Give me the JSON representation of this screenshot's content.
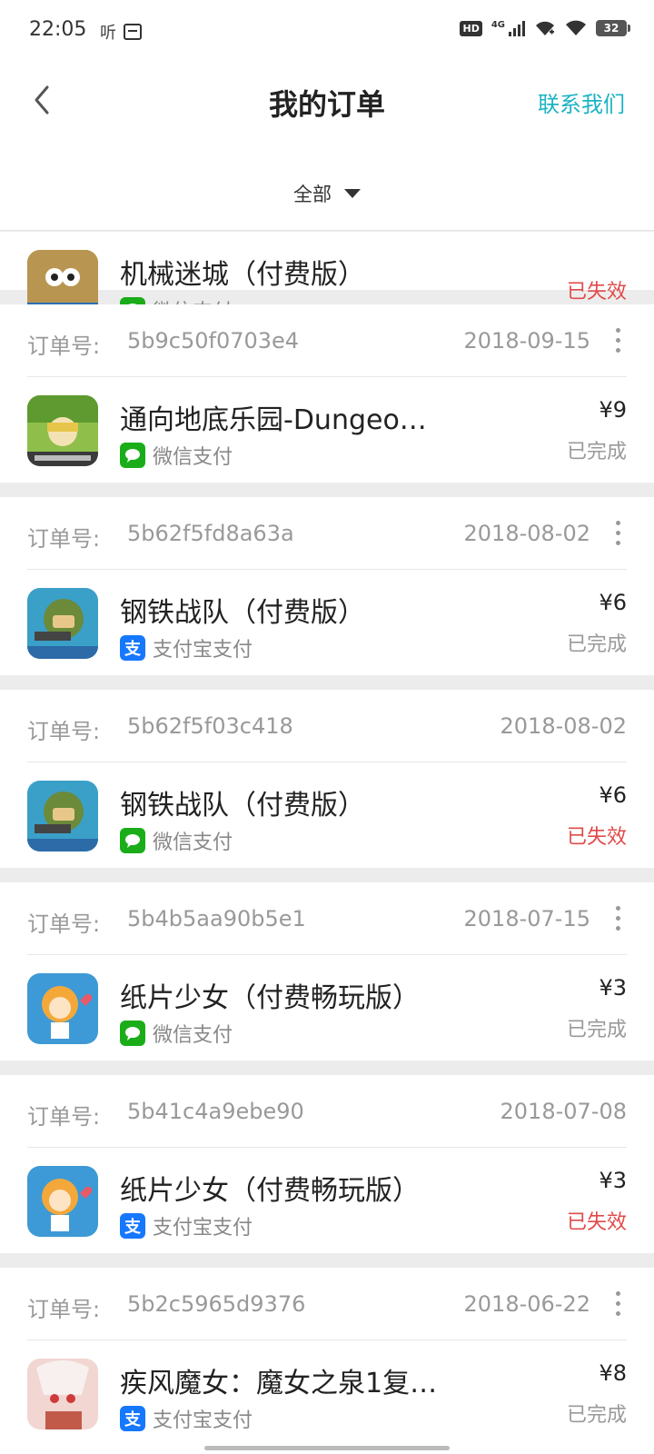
{
  "status_bar": {
    "time": "22:05",
    "listen_glyph": "听",
    "net_tag": "4G",
    "battery": "32"
  },
  "header": {
    "title": "我的订单",
    "contact": "联系我们"
  },
  "filter": {
    "selected": "全部"
  },
  "order_no_label": "订单号:",
  "orders": [
    {
      "app_name": "机械迷城（付费版）",
      "payment": "微信支付",
      "pay_type": "wechat",
      "status": "已失效",
      "status_type": "failed",
      "icon": "machinarium-icon"
    },
    {
      "order_no": "5b9c50f0703e4",
      "date": "2018-09-15",
      "app_name": "通向地底乐园-Dungeo…",
      "price": "¥9",
      "payment": "微信支付",
      "pay_type": "wechat",
      "status": "已完成",
      "status_type": "done",
      "icon": "game-coaster-icon"
    },
    {
      "order_no": "5b62f5fd8a63a",
      "date": "2018-08-02",
      "app_name": "钢铁战队（付费版）",
      "price": "¥6",
      "payment": "支付宝支付",
      "pay_type": "alipay",
      "status": "已完成",
      "status_type": "done",
      "icon": "iron-squad-icon"
    },
    {
      "order_no": "5b62f5f03c418",
      "date": "2018-08-02",
      "app_name": "钢铁战队（付费版）",
      "price": "¥6",
      "payment": "微信支付",
      "pay_type": "wechat",
      "status": "已失效",
      "status_type": "failed",
      "icon": "iron-squad-icon"
    },
    {
      "order_no": "5b4b5aa90b5e1",
      "date": "2018-07-15",
      "app_name": "纸片少女（付费畅玩版）",
      "price": "¥3",
      "payment": "微信支付",
      "pay_type": "wechat",
      "status": "已完成",
      "status_type": "done",
      "icon": "paper-girl-icon"
    },
    {
      "order_no": "5b41c4a9ebe90",
      "date": "2018-07-08",
      "app_name": "纸片少女（付费畅玩版）",
      "price": "¥3",
      "payment": "支付宝支付",
      "pay_type": "alipay",
      "status": "已失效",
      "status_type": "failed",
      "icon": "paper-girl-icon"
    },
    {
      "order_no": "5b2c5965d9376",
      "date": "2018-06-22",
      "app_name": "疾风魔女：魔女之泉1复…",
      "price": "¥8",
      "payment": "支付宝支付",
      "pay_type": "alipay",
      "status": "已完成",
      "status_type": "done",
      "icon": "witch-icon"
    }
  ],
  "colors": {
    "accent": "#1bb3c3",
    "failed": "#e04a4a",
    "wechat": "#1aad19",
    "alipay": "#1677ff"
  }
}
